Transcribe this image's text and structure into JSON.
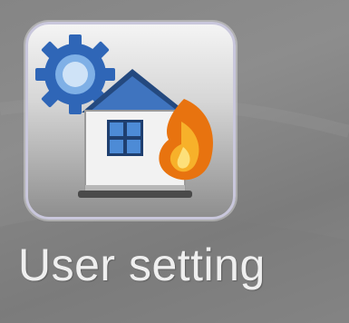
{
  "desktop": {
    "shortcut": {
      "label": "User setting",
      "icon": "house-settings-icon",
      "icon_parts": [
        "gear-icon",
        "house-icon",
        "window-icon",
        "flame-icon"
      ]
    }
  },
  "colors": {
    "background": "#868686",
    "tile_border": "#c9c7dc",
    "label_text": "#efefef",
    "gear": "#3a6fc0",
    "roof": "#2f5d9e",
    "window": "#3b78c8",
    "flame": "#f59a1b"
  }
}
